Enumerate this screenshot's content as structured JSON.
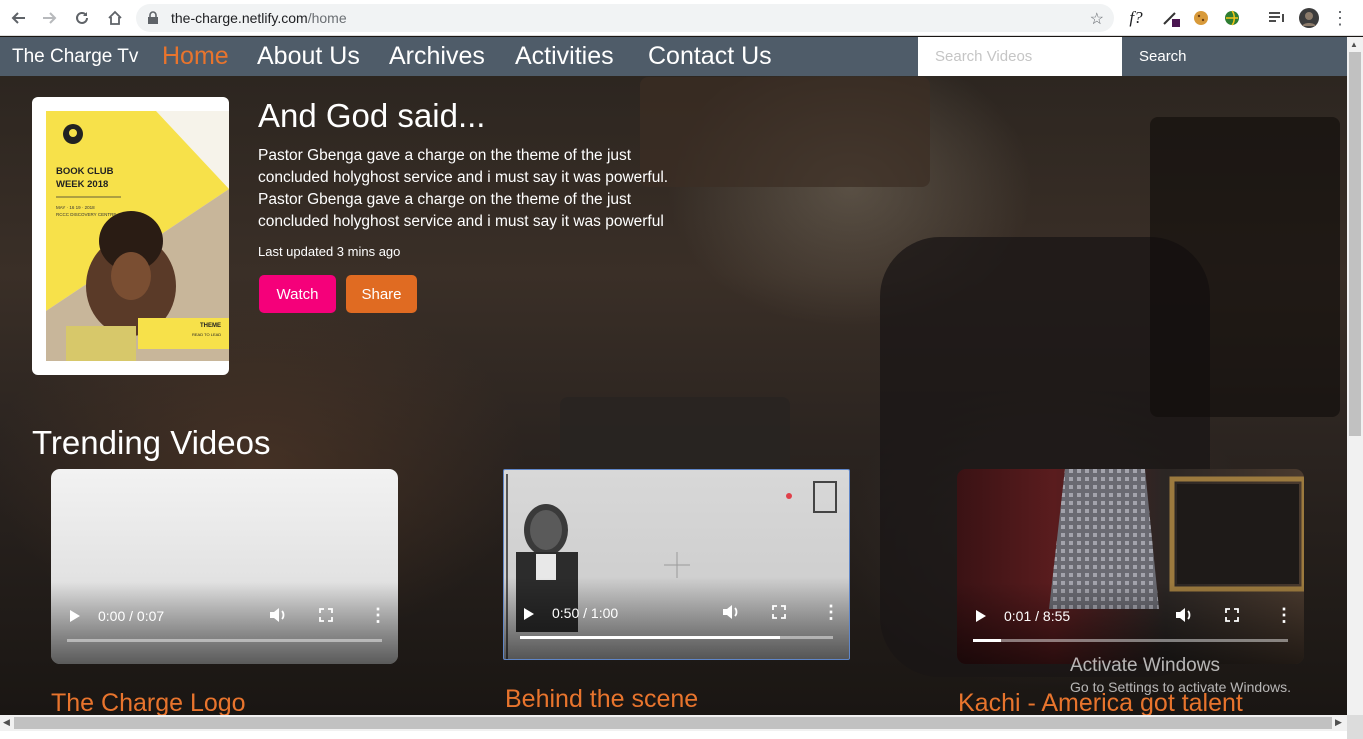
{
  "browser": {
    "url_host": "the-charge.netlify.com",
    "url_path": "/home",
    "ext_font_label": "f?"
  },
  "nav": {
    "brand": "The Charge Tv",
    "links": [
      "Home",
      "About Us",
      "Archives",
      "Activities",
      "Contact Us"
    ],
    "active_index": 0,
    "search_placeholder": "Search Videos",
    "search_button": "Search"
  },
  "hero": {
    "title": "And God said...",
    "description": "Pastor Gbenga gave a charge on the theme of the just concluded holyghost service and i must say it was powerful. Pastor Gbenga gave a charge on the theme of the just concluded holyghost service and i must say it was powerful",
    "updated": "Last updated 3 mins ago",
    "watch_label": "Watch",
    "share_label": "Share",
    "poster": {
      "heading_line1": "BOOK CLUB",
      "heading_line2": "WEEK 2018",
      "small_text_1": "MAY · 16 19 · 2018",
      "small_text_2": "RCCC DISCOVERY CENTRE",
      "theme_label": "THEME",
      "theme_sub": "READ TO LEAD"
    }
  },
  "trending": {
    "title": "Trending Videos",
    "videos": [
      {
        "time": "0:00 / 0:07",
        "progress": 0.0,
        "title": "The Charge Logo"
      },
      {
        "time": "0:50 / 1:00",
        "progress": 0.83,
        "title": "Behind the scene"
      },
      {
        "time": "0:01 / 8:55",
        "progress": 0.09,
        "title": "Kachi - America got talent"
      }
    ]
  },
  "watermark": {
    "line1": "Activate Windows",
    "line2": "Go to Settings to activate Windows."
  },
  "colors": {
    "navbar": "#4f5c69",
    "accent_orange": "#e8742d",
    "watch_pink": "#f5007a",
    "share_orange": "#e06b22",
    "poster_yellow": "#f7e14a"
  }
}
